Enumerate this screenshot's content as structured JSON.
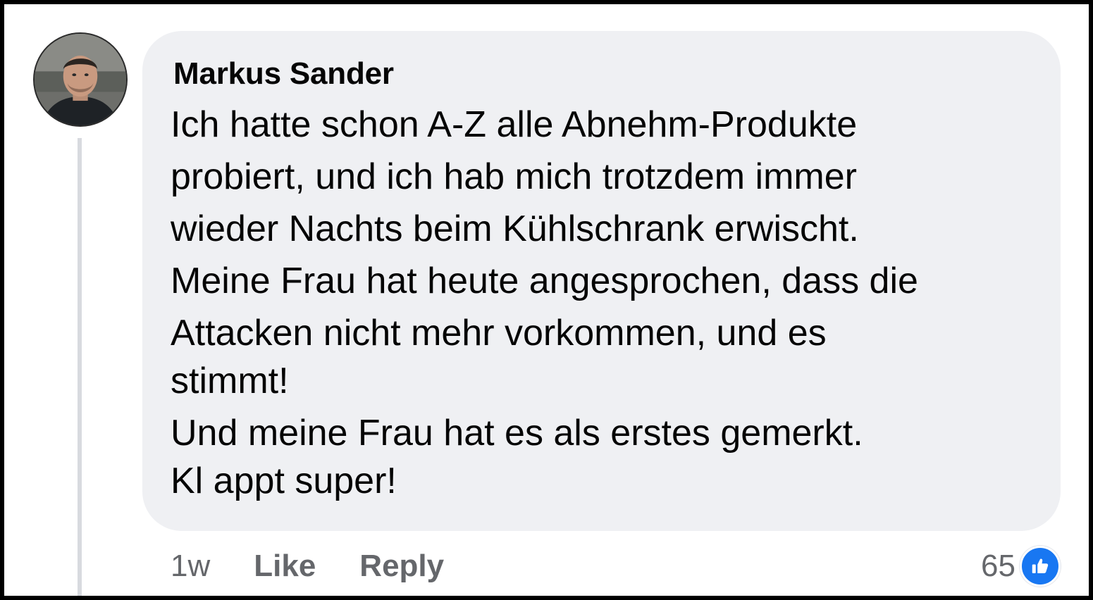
{
  "comment": {
    "author": "Markus Sander",
    "text_lines": [
      "Ich hatte schon A-Z alle Abnehm-Produkte",
      "probiert, und ich hab mich trotzdem immer",
      "wieder Nachts beim Kühlschrank erwischt.",
      "Meine Frau hat heute angesprochen, dass die",
      "Attacken nicht mehr vorkommen, und es",
      "stimmt!",
      "Und meine Frau hat es als erstes gemerkt.",
      "Kl appt super!"
    ],
    "timestamp": "1w",
    "like_label": "Like",
    "reply_label": "Reply",
    "reaction_count": "65",
    "reaction_icon": "thumbs-up-icon"
  },
  "colors": {
    "bubble": "#eff0f3",
    "meta_text": "#65676b",
    "like_blue": "#1877f2"
  }
}
